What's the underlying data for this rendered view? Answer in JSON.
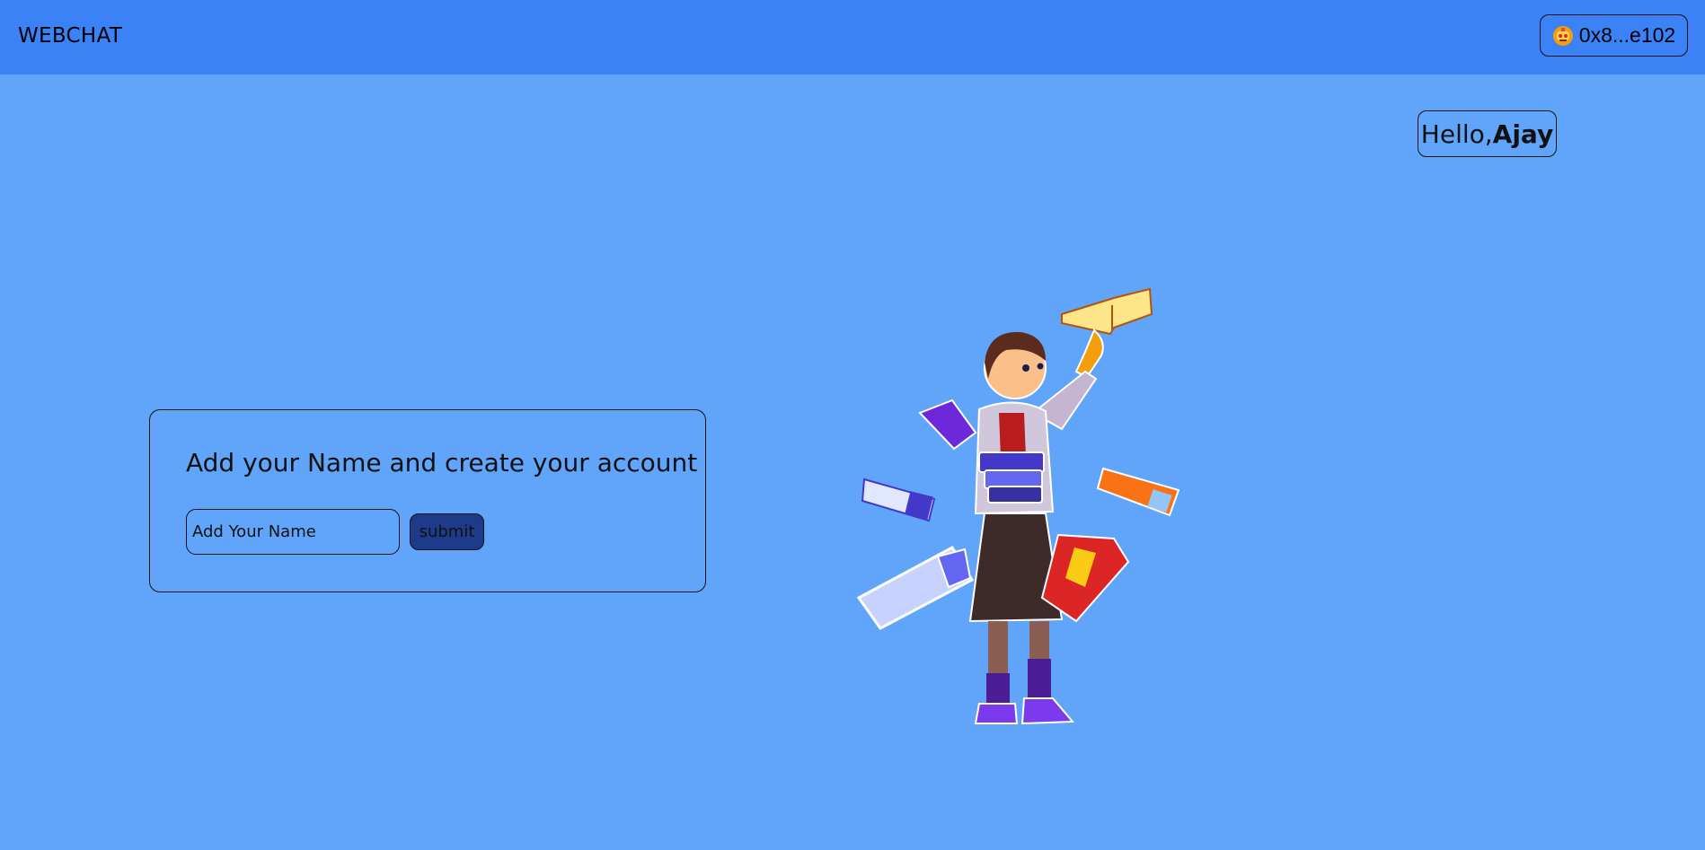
{
  "navbar": {
    "brand": "WEBCHAT",
    "wallet": {
      "address": "0x8...e102",
      "avatar_icon": "robot-avatar-icon"
    }
  },
  "greeting": {
    "prefix": "Hello,",
    "name": "Ajay"
  },
  "signup_card": {
    "title": "Add your Name and create your account",
    "name_input": {
      "value": "",
      "placeholder": "Add Your Name"
    },
    "submit_label": "submit"
  },
  "illustration": {
    "icon": "girl-with-books-illustration"
  },
  "colors": {
    "navbar": "#3b82f6",
    "background": "#60a5fa",
    "submit_button": "#1e3a8a"
  }
}
